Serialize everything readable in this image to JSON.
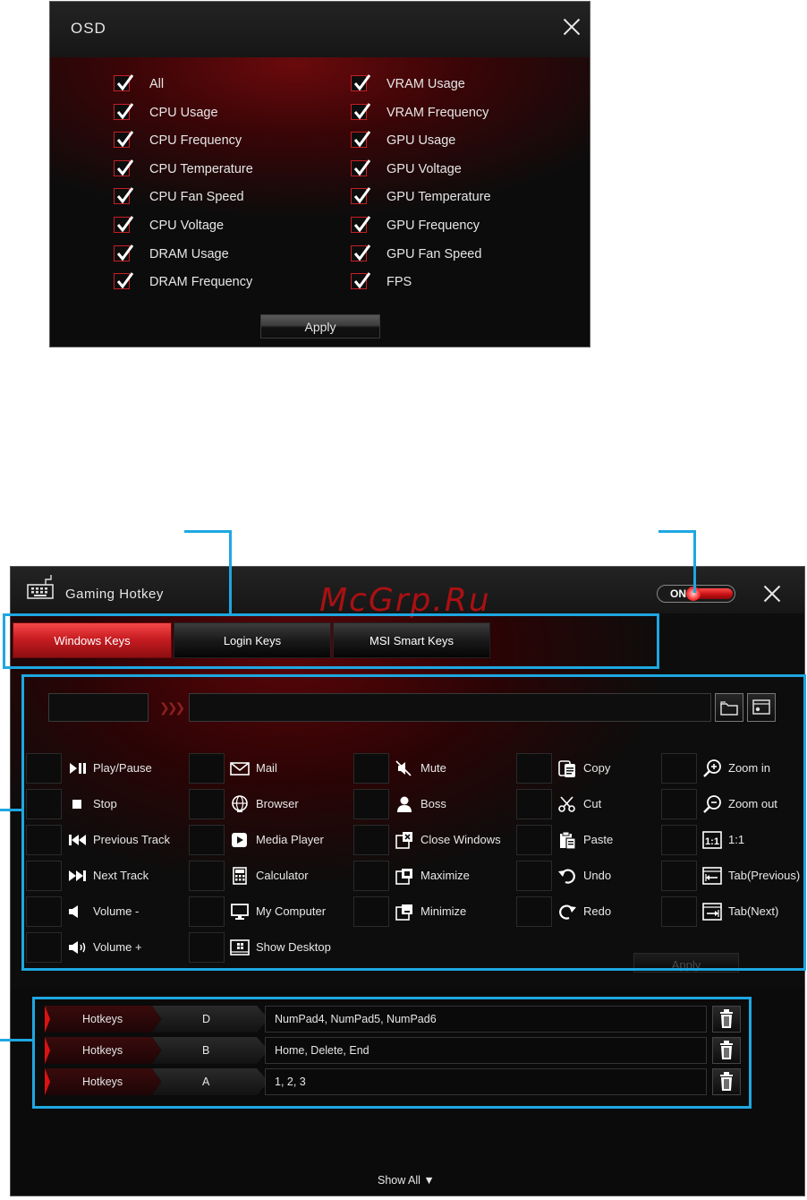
{
  "osd": {
    "title": "OSD",
    "left_items": [
      "All",
      "CPU Usage",
      "CPU Frequency",
      "CPU Temperature",
      "CPU Fan Speed",
      "CPU Voltage",
      "DRAM Usage",
      "DRAM Frequency"
    ],
    "right_items": [
      "VRAM Usage",
      "VRAM Frequency",
      "GPU Usage",
      "GPU Voltage",
      "GPU Temperature",
      "GPU Frequency",
      "GPU Fan Speed",
      "FPS"
    ],
    "apply_label": "Apply",
    "accent": "#c81e25"
  },
  "gaming_hotkey": {
    "title": "Gaming Hotkey",
    "toggle_label": "ON",
    "tabs": [
      "Windows Keys",
      "Login Keys",
      "MSI Smart Keys"
    ],
    "functions": {
      "col1": [
        {
          "icon": "play-pause-icon",
          "label": "Play/Pause"
        },
        {
          "icon": "stop-icon",
          "label": "Stop"
        },
        {
          "icon": "previous-track-icon",
          "label": "Previous Track"
        },
        {
          "icon": "next-track-icon",
          "label": "Next Track"
        },
        {
          "icon": "volume-down-icon",
          "label": "Volume -"
        },
        {
          "icon": "volume-up-icon",
          "label": "Volume +"
        }
      ],
      "col2": [
        {
          "icon": "mail-icon",
          "label": "Mail"
        },
        {
          "icon": "browser-icon",
          "label": "Browser"
        },
        {
          "icon": "media-player-icon",
          "label": "Media Player"
        },
        {
          "icon": "calculator-icon",
          "label": "Calculator"
        },
        {
          "icon": "my-computer-icon",
          "label": "My Computer"
        },
        {
          "icon": "show-desktop-icon",
          "label": "Show Desktop"
        }
      ],
      "col3": [
        {
          "icon": "mute-icon",
          "label": "Mute"
        },
        {
          "icon": "boss-icon",
          "label": "Boss"
        },
        {
          "icon": "close-windows-icon",
          "label": "Close Windows"
        },
        {
          "icon": "maximize-icon",
          "label": "Maximize"
        },
        {
          "icon": "minimize-icon",
          "label": "Minimize"
        }
      ],
      "col4": [
        {
          "icon": "copy-icon",
          "label": "Copy"
        },
        {
          "icon": "cut-icon",
          "label": "Cut"
        },
        {
          "icon": "paste-icon",
          "label": "Paste"
        },
        {
          "icon": "undo-icon",
          "label": "Undo"
        },
        {
          "icon": "redo-icon",
          "label": "Redo"
        }
      ],
      "col5": [
        {
          "icon": "zoom-in-icon",
          "label": "Zoom in"
        },
        {
          "icon": "zoom-out-icon",
          "label": "Zoom out"
        },
        {
          "icon": "one-to-one-icon",
          "label": "1:1"
        },
        {
          "icon": "tab-previous-icon",
          "label": "Tab(Previous)"
        },
        {
          "icon": "tab-next-icon",
          "label": "Tab(Next)"
        }
      ]
    },
    "apply_label": "Apply",
    "hotkey_rows": [
      {
        "type": "Hotkeys",
        "key": "D",
        "mapping": "NumPad4, NumPad5, NumPad6"
      },
      {
        "type": "Hotkeys",
        "key": "B",
        "mapping": "Home, Delete, End"
      },
      {
        "type": "Hotkeys",
        "key": "A",
        "mapping": "1, 2, 3"
      }
    ],
    "show_all_label": "Show All ▼",
    "accent": "#c81d22"
  },
  "watermark": "McGrp.Ru",
  "callout_color": "#1ea7e1"
}
